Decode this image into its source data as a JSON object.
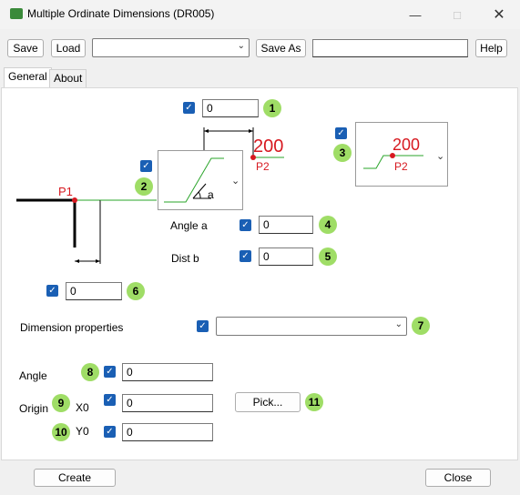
{
  "window": {
    "title": "Multiple Ordinate Dimensions (DR005)",
    "colors": {
      "accent": "#1a5fb4",
      "marker": "#9fdd66",
      "dim_red": "#d71920",
      "line_green": "#2aa52a"
    }
  },
  "toolbar": {
    "save": "Save",
    "load": "Load",
    "preset_value": "",
    "save_as": "Save As",
    "save_as_name": "",
    "help": "Help"
  },
  "tabs": [
    {
      "label": "General"
    },
    {
      "label": "About"
    }
  ],
  "fields": {
    "f1": "0",
    "angle_a": "0",
    "dist_b": "0",
    "f6": "0",
    "dim_props": "",
    "angle": "0",
    "x0": "0",
    "y0": "0"
  },
  "labels": {
    "angle_a": "Angle a",
    "dist_b": "Dist b",
    "dim_props": "Dimension properties",
    "angle": "Angle",
    "origin": "Origin",
    "x0": "X0",
    "y0": "Y0"
  },
  "markers": [
    "1",
    "2",
    "3",
    "4",
    "5",
    "6",
    "7",
    "8",
    "9",
    "10",
    "11"
  ],
  "diagram": {
    "p1": "P1",
    "p2": "P2",
    "value": "200",
    "a": "a"
  },
  "buttons": {
    "pick": "Pick...",
    "create": "Create",
    "close": "Close"
  }
}
